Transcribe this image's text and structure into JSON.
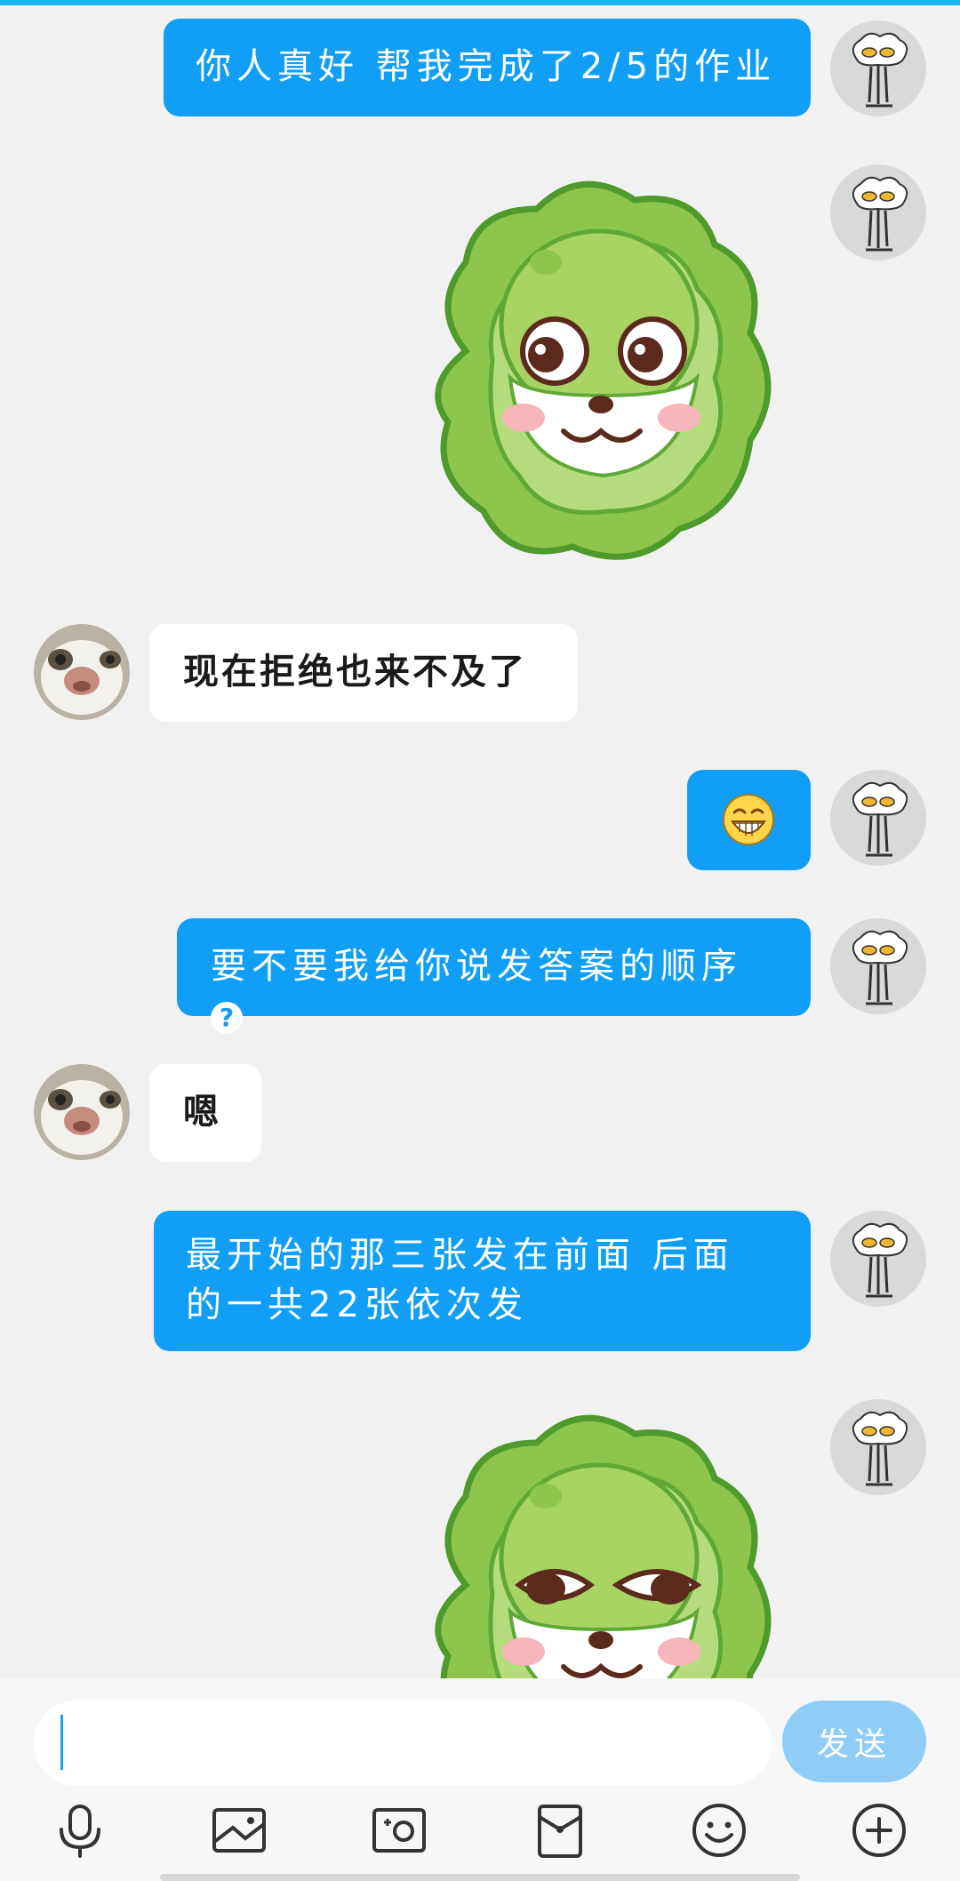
{
  "messages": [
    {
      "from": "me",
      "text": "你人真好 帮我完成了2/5的作业"
    },
    {
      "from": "me",
      "type": "sticker",
      "sticker": "cabbage-dog-sticker"
    },
    {
      "from": "friend",
      "text": "现在拒绝也来不及了"
    },
    {
      "from": "me",
      "type": "emoji",
      "emoji": "grin-emoji"
    },
    {
      "from": "me",
      "text": "要不要我给你说发答案的顺序"
    },
    {
      "from": "friend",
      "text": "嗯"
    },
    {
      "from": "me",
      "lines": [
        "最开始的那三张发在前面 后面",
        "的一共22张依次发"
      ]
    },
    {
      "from": "me",
      "type": "sticker",
      "sticker": "cabbage-dog-sticker-sideeye"
    }
  ],
  "composer": {
    "input_value": "",
    "send_label": "发送"
  },
  "toolbar": {
    "icons": [
      "microphone-icon",
      "image-icon",
      "camera-icon",
      "red-packet-icon",
      "emoji-icon",
      "plus-icon"
    ]
  },
  "colors": {
    "my_bubble": "#109ef7",
    "friend_bubble": "#ffffff",
    "send_button": "#8fcdf7",
    "accent": "#19b3f0"
  }
}
